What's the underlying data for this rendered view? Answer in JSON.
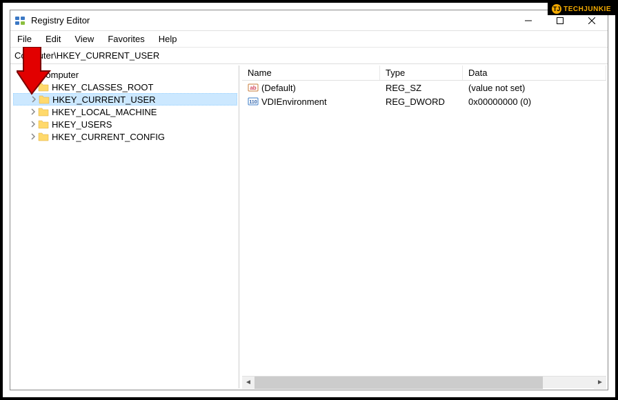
{
  "watermark": {
    "icon_text": "TJ",
    "text": "TECHJUNKIE"
  },
  "window": {
    "title": "Registry Editor",
    "address": "Computer\\HKEY_CURRENT_USER"
  },
  "menu": {
    "file": "File",
    "edit": "Edit",
    "view": "View",
    "favorites": "Favorites",
    "help": "Help"
  },
  "tree": {
    "root": "Computer",
    "items": [
      {
        "label": "HKEY_CLASSES_ROOT",
        "selected": false
      },
      {
        "label": "HKEY_CURRENT_USER",
        "selected": true
      },
      {
        "label": "HKEY_LOCAL_MACHINE",
        "selected": false
      },
      {
        "label": "HKEY_USERS",
        "selected": false
      },
      {
        "label": "HKEY_CURRENT_CONFIG",
        "selected": false
      }
    ]
  },
  "list": {
    "headers": {
      "name": "Name",
      "type": "Type",
      "data": "Data"
    },
    "rows": [
      {
        "icon": "string",
        "name": "(Default)",
        "type": "REG_SZ",
        "data": "(value not set)"
      },
      {
        "icon": "binary",
        "name": "VDIEnvironment",
        "type": "REG_DWORD",
        "data": "0x00000000 (0)"
      }
    ]
  }
}
